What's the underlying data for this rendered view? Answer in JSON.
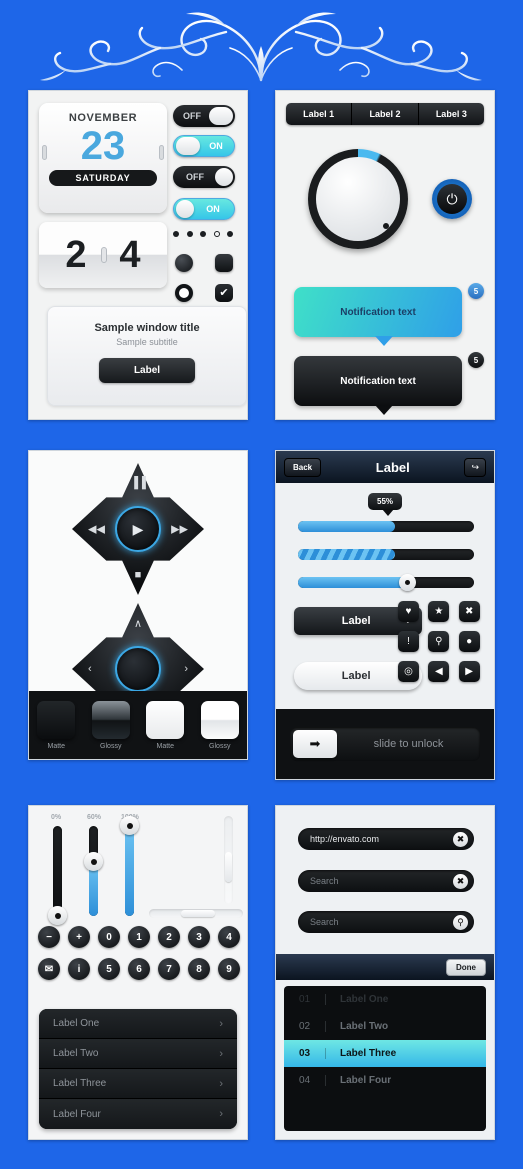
{
  "theme": {
    "background": "#1e66e8",
    "accent_blue": "#2d8fd8",
    "accent_cyan": "#3fe0c8",
    "dark": "#0d0f11"
  },
  "ornament": {
    "name": "floral-flourish-divider"
  },
  "panel_calendar": {
    "calendar": {
      "month": "NOVEMBER",
      "day": "23",
      "weekday": "SATURDAY"
    },
    "flip_clock": {
      "left": "2",
      "right": "4"
    },
    "window": {
      "title": "Sample window title",
      "subtitle": "Sample subtitle",
      "button": "Label"
    },
    "toggles": [
      {
        "label": "OFF",
        "state": "off",
        "style": "square"
      },
      {
        "label": "ON",
        "state": "on",
        "style": "square"
      },
      {
        "label": "OFF",
        "state": "off",
        "style": "round"
      },
      {
        "label": "ON",
        "state": "on",
        "style": "round"
      }
    ],
    "page_dots": {
      "count": 5,
      "active_index": 3
    },
    "controls": [
      {
        "name": "radio-selected",
        "type": "radio",
        "checked": true
      },
      {
        "name": "checkbox-unchecked",
        "type": "checkbox",
        "checked": false,
        "glyph": ""
      },
      {
        "name": "radio-unselected",
        "type": "radio",
        "checked": false
      },
      {
        "name": "checkbox-checked",
        "type": "checkbox",
        "checked": true,
        "glyph": "✔"
      }
    ]
  },
  "panel_knob": {
    "segmented": [
      "Label 1",
      "Label 2",
      "Label 3"
    ],
    "knob": {
      "name": "rotary-dial"
    },
    "power_button": {
      "glyph": "⏻"
    },
    "notifications": [
      {
        "text": "Notification text",
        "style": "cyan",
        "badge": "5"
      },
      {
        "text": "Notification text",
        "style": "dark",
        "badge": "5"
      }
    ]
  },
  "panel_media": {
    "media_pad": {
      "up": "▐▐",
      "left": "◀◀",
      "center": "▶",
      "right": "▶▶",
      "down": "■"
    },
    "dir_pad": {
      "up": "∧",
      "left": "‹",
      "center": "",
      "right": "›",
      "down": "∨"
    },
    "swatches": [
      {
        "label": "Matte",
        "finish": "dark-matte"
      },
      {
        "label": "Glossy",
        "finish": "dark-glossy"
      },
      {
        "label": "Matte",
        "finish": "light-matte"
      },
      {
        "label": "Glossy",
        "finish": "light-glossy"
      }
    ]
  },
  "panel_progress": {
    "navbar": {
      "back": "Back",
      "title": "Label",
      "share_glyph": "↪"
    },
    "tooltip": "55%",
    "bars": [
      {
        "name": "progress-bar",
        "value": 55,
        "style": "solid"
      },
      {
        "name": "striped-progress-bar",
        "value": 55,
        "style": "striped"
      },
      {
        "name": "slider",
        "value": 62,
        "style": "slider"
      }
    ],
    "buttons": [
      {
        "label": "Label",
        "style": "dark",
        "chevron": "›"
      },
      {
        "label": "Label",
        "style": "light",
        "chevron": "›"
      }
    ],
    "icon_grid": [
      {
        "name": "heart-icon",
        "glyph": "♥"
      },
      {
        "name": "star-icon",
        "glyph": "★"
      },
      {
        "name": "close-icon",
        "glyph": "✖"
      },
      {
        "name": "exclamation-icon",
        "glyph": "!"
      },
      {
        "name": "search-icon",
        "glyph": "⚲"
      },
      {
        "name": "location-pin-icon",
        "glyph": "●"
      },
      {
        "name": "record-icon",
        "glyph": "◎"
      },
      {
        "name": "arrow-left-icon",
        "glyph": "◀"
      },
      {
        "name": "arrow-right-icon",
        "glyph": "▶"
      }
    ],
    "unlock": {
      "text": "slide to unlock",
      "handle_glyph": "➡"
    }
  },
  "panel_sliders": {
    "vertical_sliders": [
      {
        "label": "0%",
        "value": 0
      },
      {
        "label": "60%",
        "value": 60
      },
      {
        "label": "100%",
        "value": 100
      }
    ],
    "round_buttons_row1": [
      "−",
      "+",
      "0",
      "1",
      "2",
      "3",
      "4"
    ],
    "round_buttons_row2": [
      "✉",
      "i",
      "5",
      "6",
      "7",
      "8",
      "9"
    ],
    "list": [
      {
        "label": "Label One",
        "chevron": "›"
      },
      {
        "label": "Label Two",
        "chevron": "›"
      },
      {
        "label": "Label Three",
        "chevron": "›"
      },
      {
        "label": "Label Four",
        "chevron": "›"
      }
    ]
  },
  "panel_search": {
    "fields": [
      {
        "value": "http://envato.com",
        "type": "filled",
        "icon": "clear-icon",
        "glyph": "✖"
      },
      {
        "value": "Search",
        "type": "placeholder",
        "icon": "clear-icon",
        "glyph": "✖"
      },
      {
        "value": "Search",
        "type": "placeholder",
        "icon": "search-icon",
        "glyph": "⚲"
      }
    ],
    "picker": {
      "done": "Done",
      "rows": [
        {
          "number": "01",
          "label": "Label One",
          "state": "faded"
        },
        {
          "number": "02",
          "label": "Label Two",
          "state": "normal"
        },
        {
          "number": "03",
          "label": "Label Three",
          "state": "selected"
        },
        {
          "number": "04",
          "label": "Label Four",
          "state": "normal"
        }
      ]
    }
  }
}
